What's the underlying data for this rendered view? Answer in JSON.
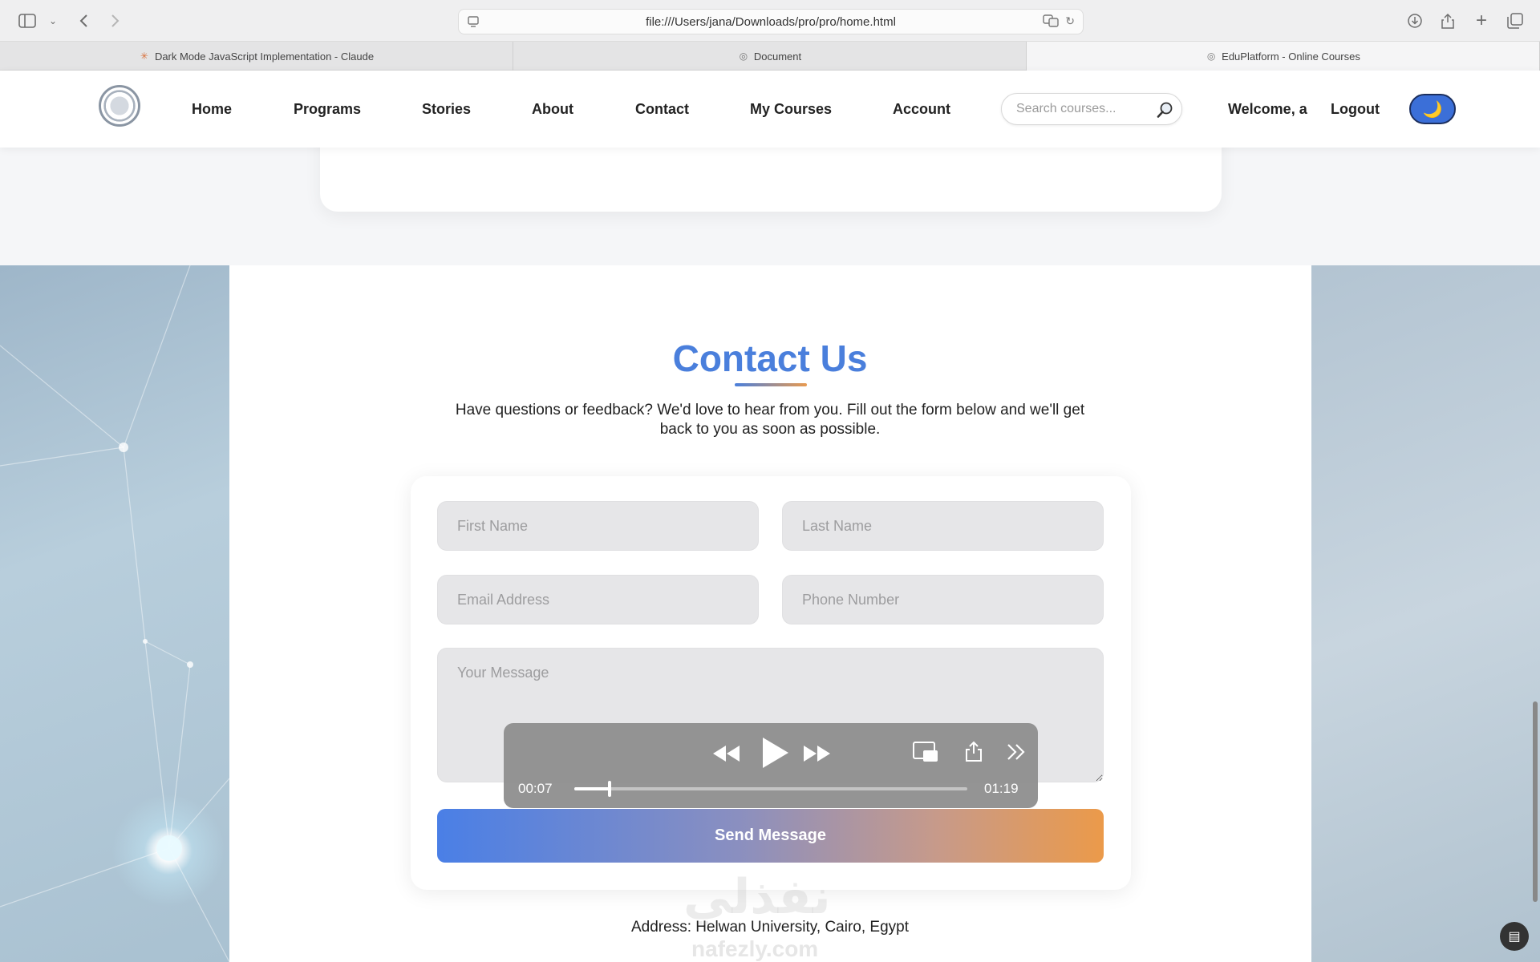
{
  "browser": {
    "url": "file:///Users/jana/Downloads/pro/pro/home.html",
    "tabs": [
      {
        "label": "Dark Mode JavaScript Implementation - Claude",
        "active": false
      },
      {
        "label": "Document",
        "active": false
      },
      {
        "label": "EduPlatform - Online Courses",
        "active": true
      }
    ]
  },
  "nav": {
    "links": [
      "Home",
      "Programs",
      "Stories",
      "About",
      "Contact",
      "My Courses",
      "Account"
    ],
    "search_placeholder": "Search courses...",
    "welcome": "Welcome, a",
    "logout": "Logout",
    "dark_toggle_icon": "🌙"
  },
  "contact": {
    "title": "Contact Us",
    "subtitle": "Have questions or feedback? We'd love to hear from you. Fill out the form below and we'll get back to you as soon as possible.",
    "first_name_placeholder": "First Name",
    "last_name_placeholder": "Last Name",
    "email_placeholder": "Email Address",
    "phone_placeholder": "Phone Number",
    "message_placeholder": "Your Message",
    "send_label": "Send Message",
    "address": "Address: Helwan University, Cairo, Egypt"
  },
  "player": {
    "elapsed": "00:07",
    "duration": "01:19",
    "progress": 0.09
  },
  "watermark": {
    "arabic": "نفذلي",
    "latin": "nafezly.com"
  },
  "colors": {
    "accent": "#4a7fdc",
    "gradient_end": "#eb9a4a"
  }
}
